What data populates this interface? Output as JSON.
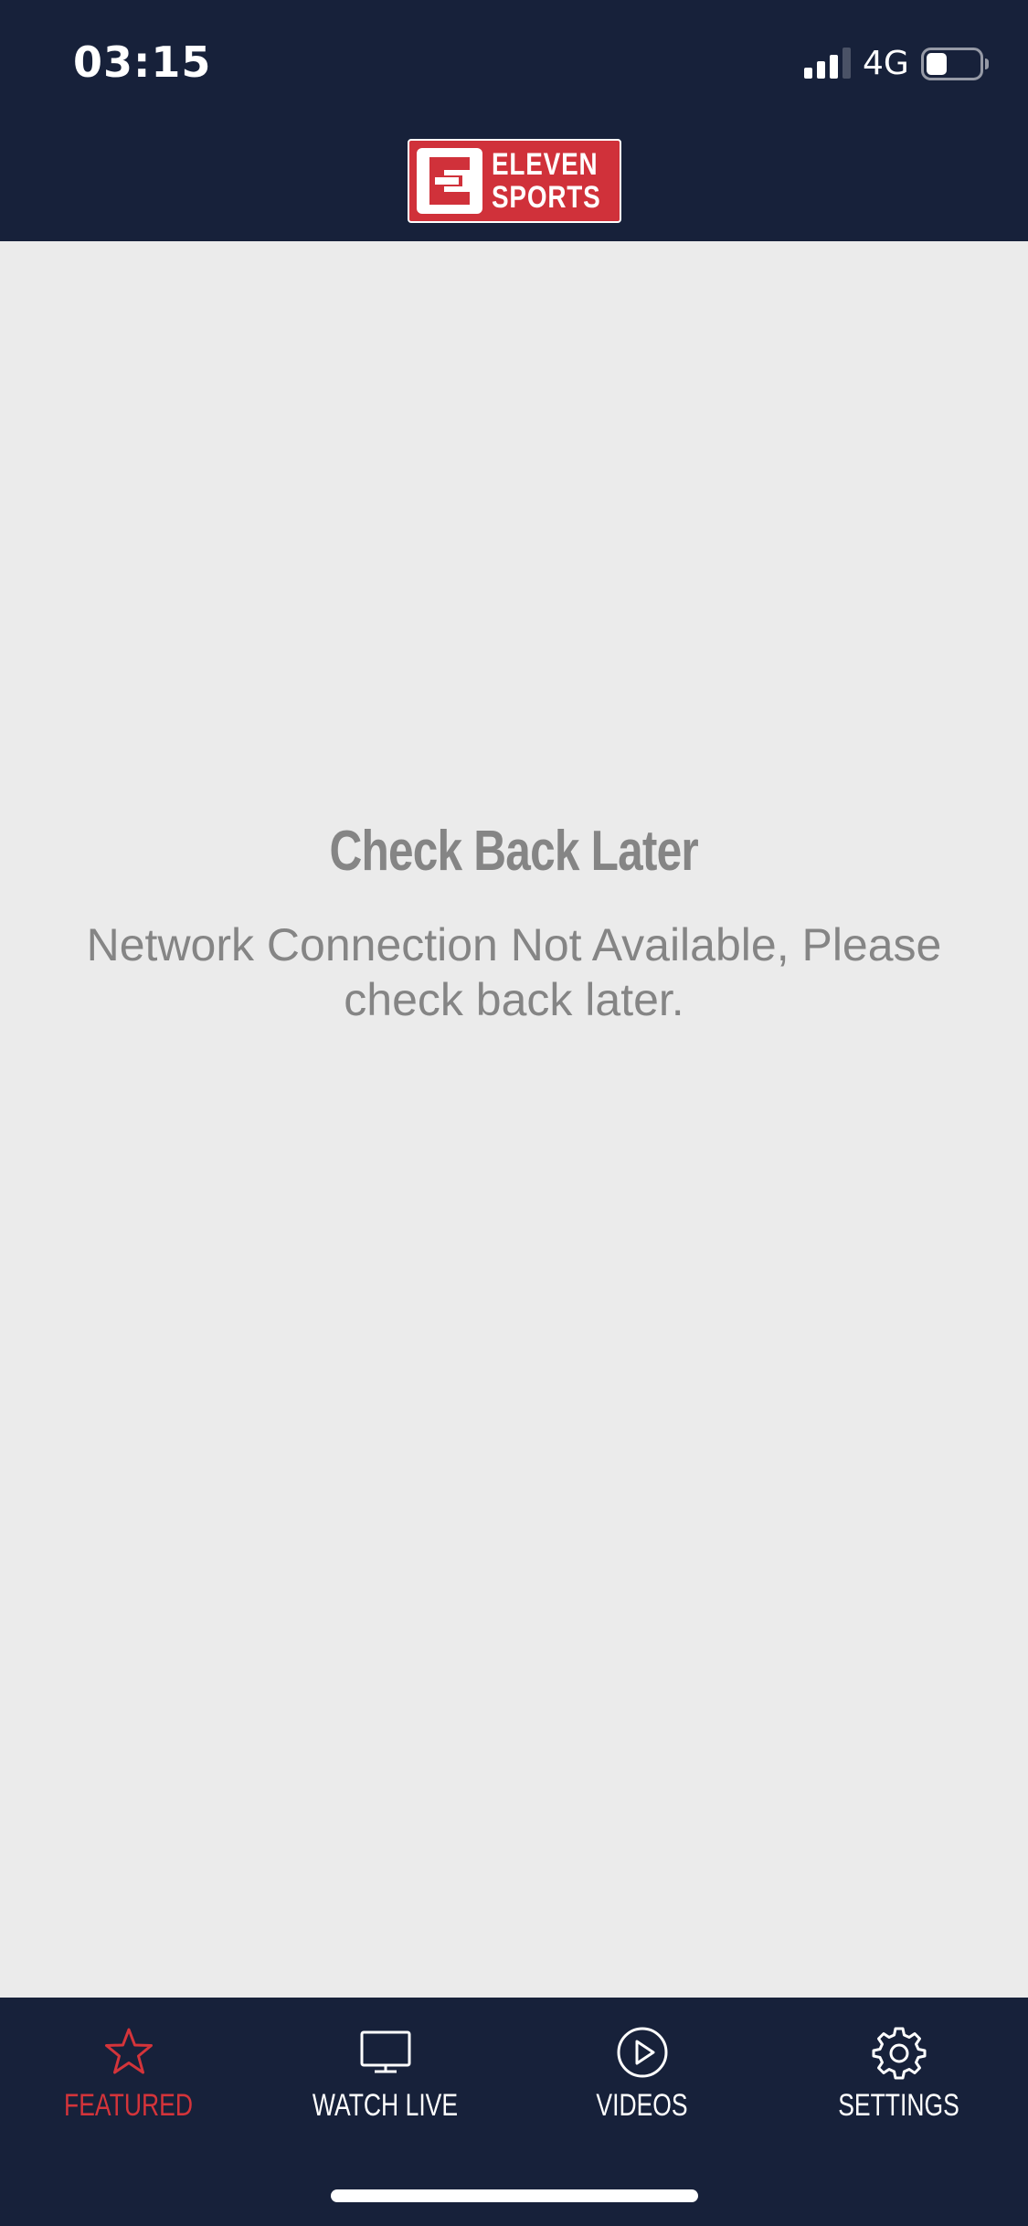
{
  "status_bar": {
    "time": "03:15",
    "network": "4G",
    "signal_bars_filled": 3,
    "signal_bars_total": 4,
    "battery_level": 0.35
  },
  "header": {
    "logo_line1": "ELEVEN",
    "logo_line2": "SPORTS",
    "brand_color": "#d0313a",
    "bar_color": "#17213a"
  },
  "message": {
    "title": "Check Back Later",
    "body": "Network Connection Not Available, Please check back later."
  },
  "tabs": [
    {
      "label": "FEATURED",
      "icon": "star-icon",
      "active": true
    },
    {
      "label": "WATCH LIVE",
      "icon": "tv-icon",
      "active": false
    },
    {
      "label": "VIDEOS",
      "icon": "play-circle-icon",
      "active": false
    },
    {
      "label": "SETTINGS",
      "icon": "gear-icon",
      "active": false
    }
  ],
  "colors": {
    "active_tab": "#d4343a",
    "inactive_tab": "#ffffff",
    "background": "#ebebeb",
    "message_text": "#858585"
  }
}
